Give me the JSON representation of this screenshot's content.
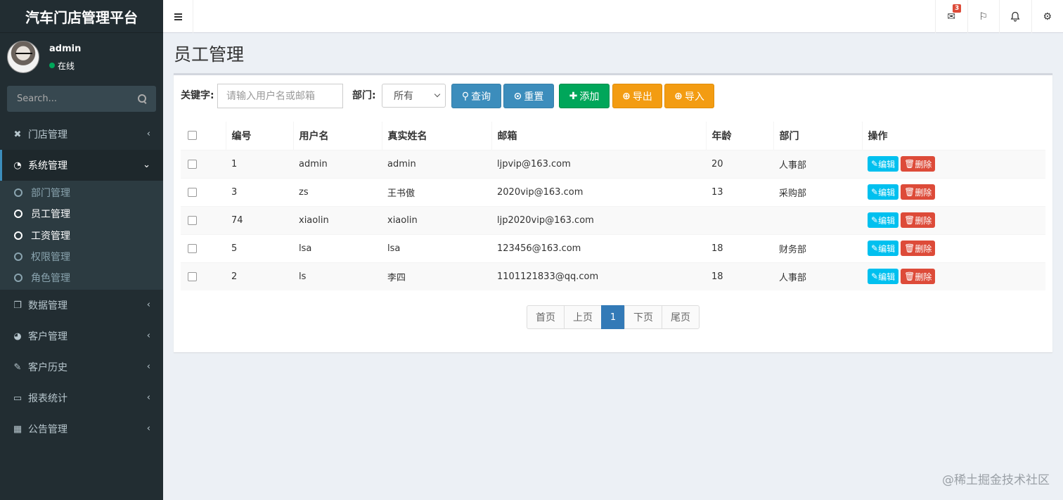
{
  "app": {
    "title": "汽车门店管理平台"
  },
  "user": {
    "name": "admin",
    "status": "在线"
  },
  "search": {
    "placeholder": "Search..."
  },
  "menu": {
    "store": "门店管理",
    "system": "系统管理",
    "system_children": [
      "部门管理",
      "员工管理",
      "工资管理",
      "权限管理",
      "角色管理"
    ],
    "data": "数据管理",
    "customer": "客户管理",
    "history": "客户历史",
    "report": "报表统计",
    "notice": "公告管理"
  },
  "topbar": {
    "mail_badge": "3"
  },
  "page": {
    "title": "员工管理"
  },
  "filter": {
    "keyword_label": "关键字:",
    "keyword_placeholder": "请输入用户名或邮箱",
    "dept_label": "部门:",
    "dept_selected": "所有",
    "btn_query": "查询",
    "btn_reset": "重置",
    "btn_add": "添加",
    "btn_export": "导出",
    "btn_import": "导入"
  },
  "table": {
    "headers": [
      "编号",
      "用户名",
      "真实姓名",
      "邮箱",
      "年龄",
      "部门",
      "操作"
    ],
    "rows": [
      {
        "id": "1",
        "username": "admin",
        "realname": "admin",
        "email": "ljpvip@163.com",
        "age": "20",
        "dept": "人事部"
      },
      {
        "id": "3",
        "username": "zs",
        "realname": "王书傲",
        "email": "2020vip@163.com",
        "age": "13",
        "dept": "采购部"
      },
      {
        "id": "74",
        "username": "xiaolin",
        "realname": "xiaolin",
        "email": "ljp2020vip@163.com",
        "age": "",
        "dept": ""
      },
      {
        "id": "5",
        "username": "lsa",
        "realname": "lsa",
        "email": "123456@163.com",
        "age": "18",
        "dept": "财务部"
      },
      {
        "id": "2",
        "username": "ls",
        "realname": "李四",
        "email": "1101121833@qq.com",
        "age": "18",
        "dept": "人事部"
      }
    ],
    "edit_label": "编辑",
    "delete_label": "删除"
  },
  "pagination": {
    "first": "首页",
    "prev": "上页",
    "current": "1",
    "next": "下页",
    "last": "尾页"
  },
  "watermark": "@稀土掘金技术社区",
  "colors": {
    "primary": "#3c8dbc",
    "success": "#00a65a",
    "warning": "#f39c12",
    "info": "#00c0ef",
    "danger": "#dd4b39",
    "sidebar": "#222d32"
  }
}
